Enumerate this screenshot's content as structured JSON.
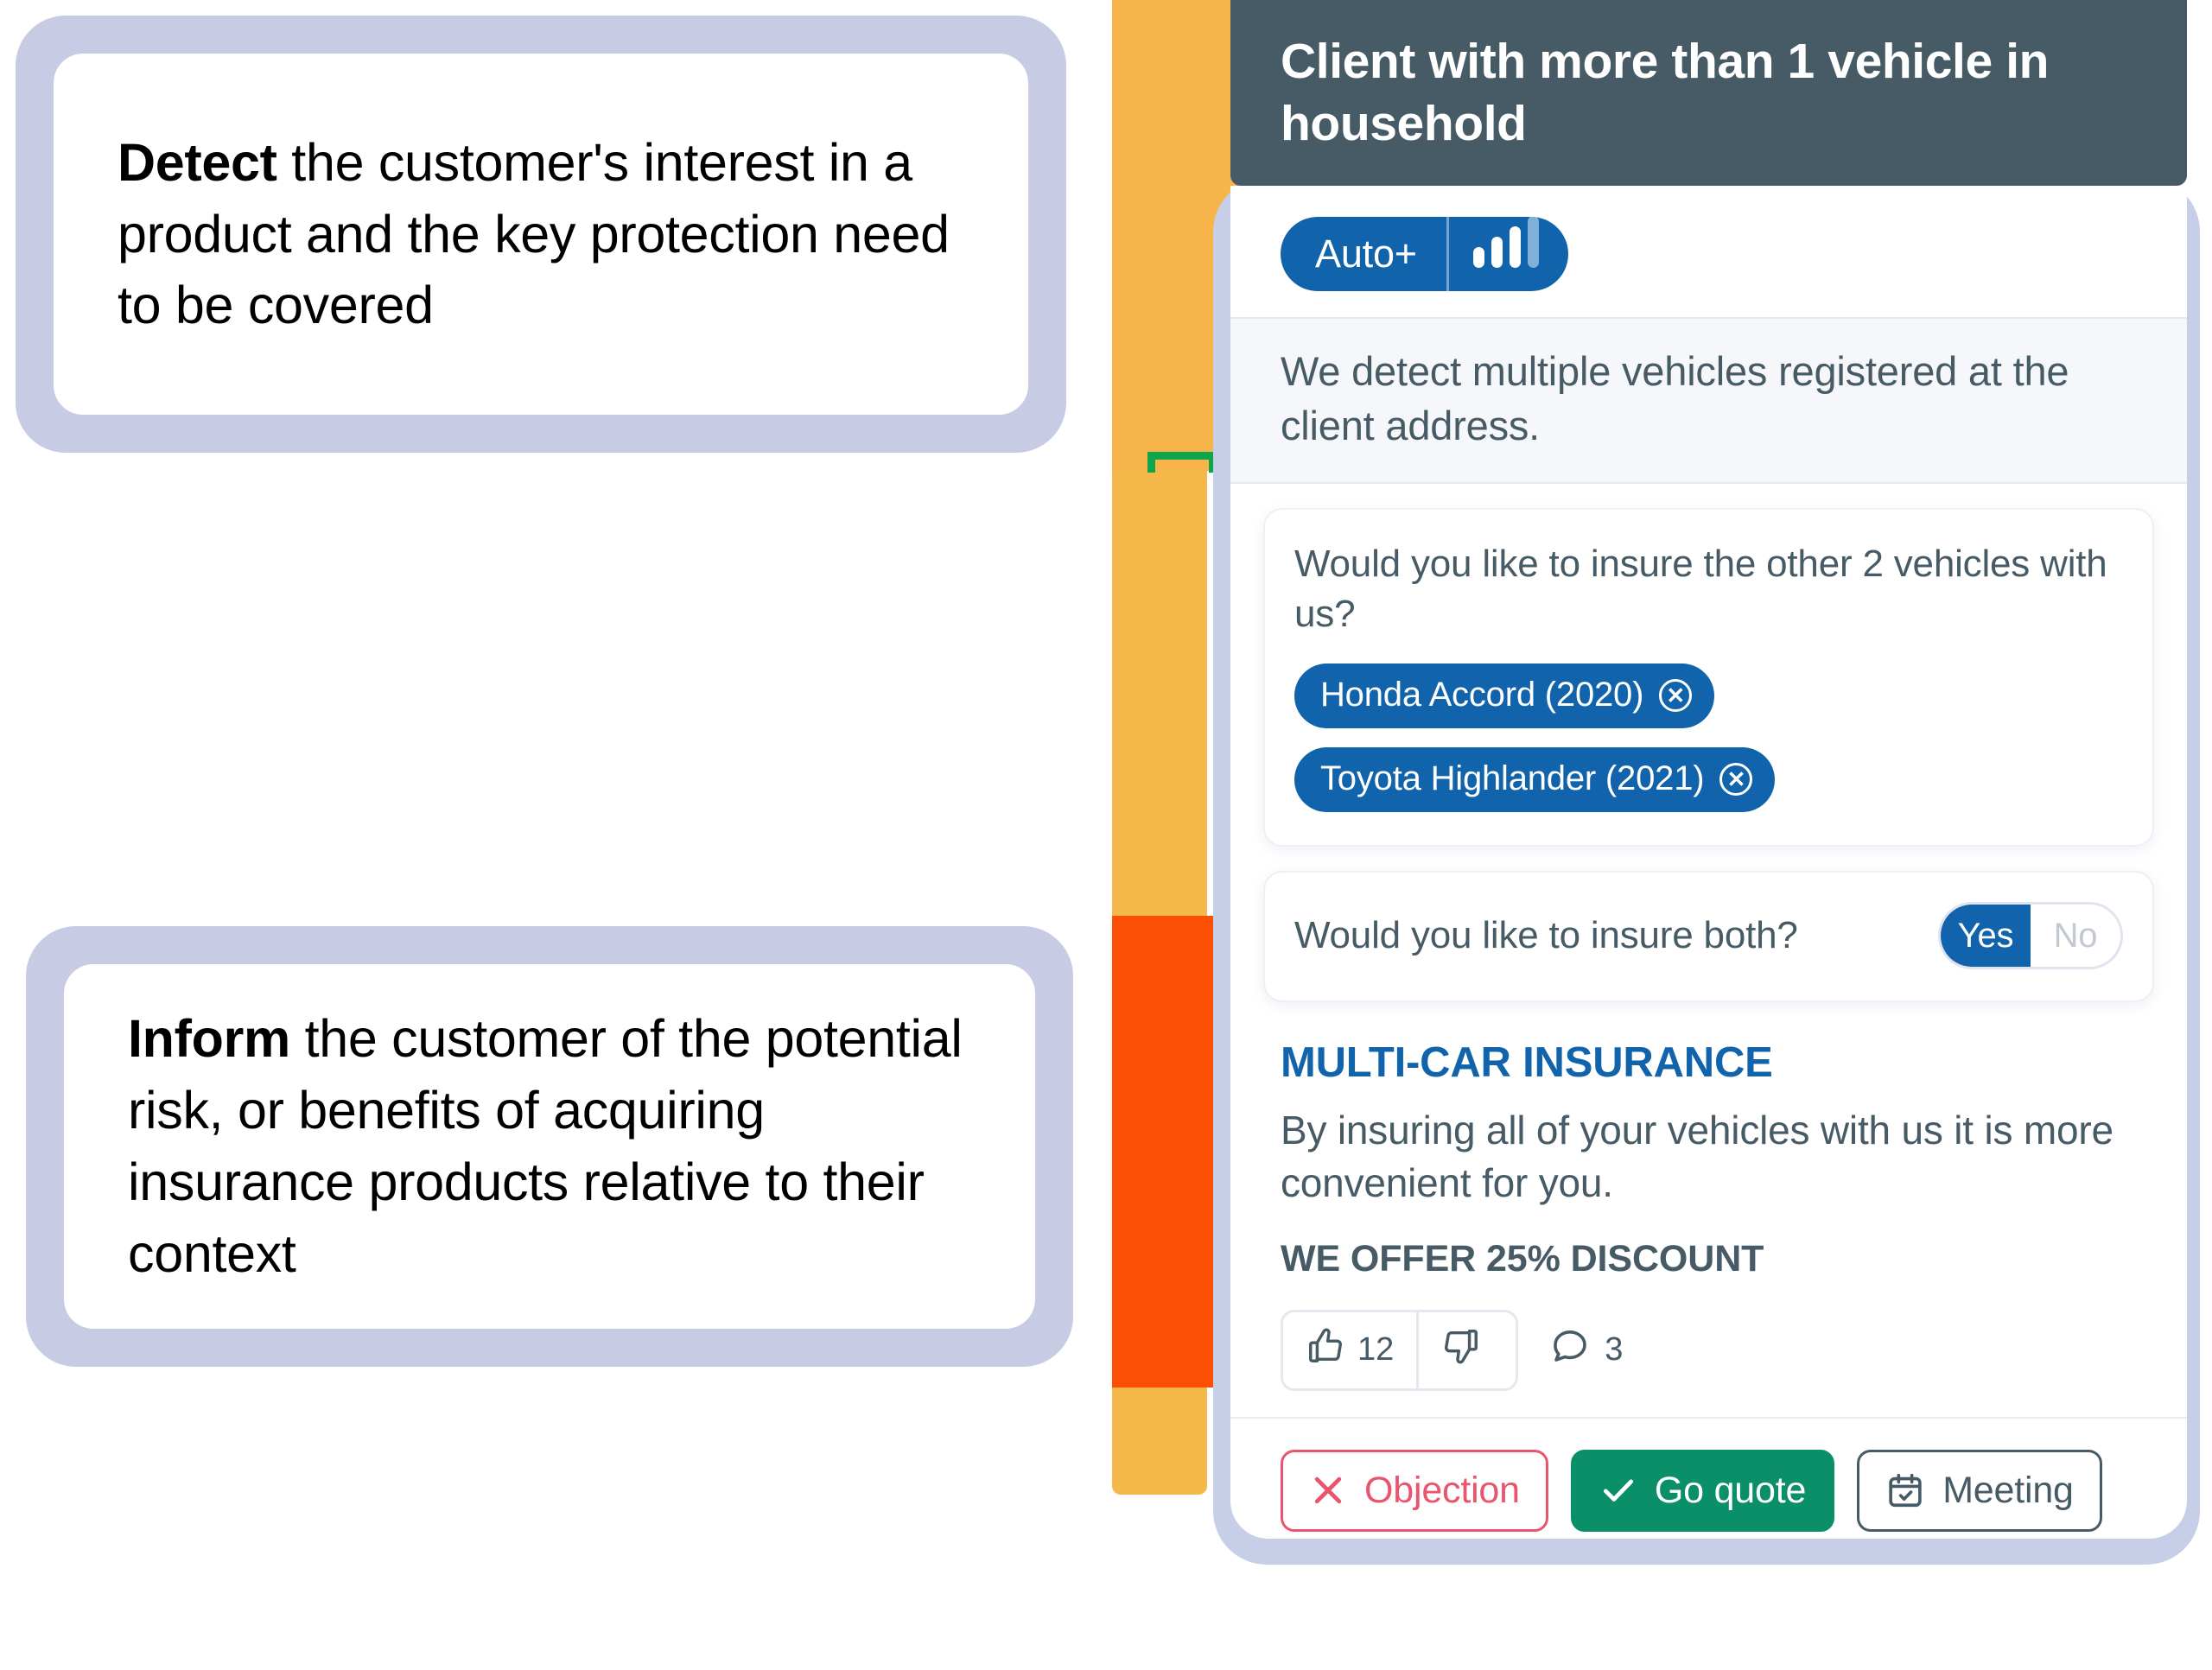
{
  "explainers": [
    {
      "lead": "Detect",
      "rest": " the customer's interest in a product and the key protection need to be covered"
    },
    {
      "lead": "Inform",
      "rest": " the customer of the potential risk, or benefits of acquiring insurance products relative to their context"
    }
  ],
  "card": {
    "header_title": "Client with more than 1 vehicle in household",
    "badge": {
      "label": "Auto+",
      "icon": "signal-bars-icon"
    },
    "detection_message": "We detect multiple vehicles registered at the client address.",
    "vehicles_panel": {
      "question": "Would you like to insure the other 2 vehicles with us?",
      "chips": [
        {
          "label": "Honda Accord (2020)",
          "remove_icon": "circle-x-icon"
        },
        {
          "label": "Toyota Highlander (2021)",
          "remove_icon": "circle-x-icon"
        }
      ]
    },
    "toggle_panel": {
      "question": "Would you like to insure both?",
      "options": [
        "Yes",
        "No"
      ],
      "selected": "Yes"
    },
    "offer": {
      "title": "MULTI-CAR INSURANCE",
      "body": "By insuring all of your vehicles with us it is more convenient for you.",
      "discount": "WE OFFER 25% DISCOUNT"
    },
    "reactions": {
      "like": {
        "icon": "thumbs-up-icon",
        "count": "12"
      },
      "dislike": {
        "icon": "thumbs-down-icon",
        "count": ""
      },
      "comments": {
        "icon": "comment-bubble-icon",
        "count": "3"
      }
    },
    "actions": [
      {
        "label": "Objection",
        "icon": "close-x-icon"
      },
      {
        "label": "Go quote",
        "icon": "check-icon"
      },
      {
        "label": "Meeting",
        "icon": "calendar-check-icon"
      }
    ]
  },
  "colors": {
    "header_dark": "#475b66",
    "brand_blue": "#1164ab",
    "amber": "#f7b44a",
    "orange": "#fb4f06",
    "green_accent": "#0ea64a",
    "frame_lavender": "#c7cee8",
    "success_green": "#0b8f68",
    "danger_red": "#e9556c"
  }
}
